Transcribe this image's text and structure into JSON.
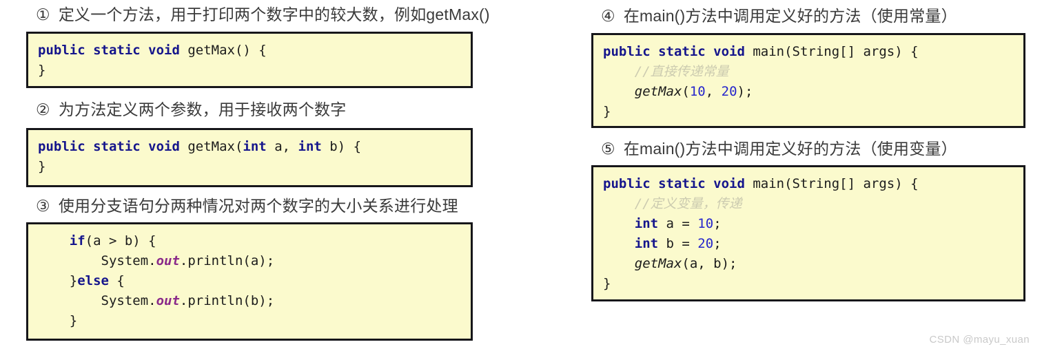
{
  "watermark": "CSDN @mayu_xuan",
  "theme": {
    "page_background": "#ffffff",
    "code_background": "#fbfacd",
    "code_border": "#16161a",
    "keyword_color": "#15158c",
    "number_color": "#2626cc",
    "comment_color": "#cccbb0",
    "field_color": "#8a2a8a",
    "heading_color": "#3a3a3a",
    "watermark_color": "#c9c9c9"
  },
  "sections": [
    {
      "marker": "①",
      "heading": "定义一个方法，用于打印两个数字中的较大数，例如getMax()",
      "code_lines": [
        {
          "tokens": [
            {
              "t": "public static void",
              "c": "kw"
            },
            {
              "t": " getMax() {",
              "c": "pl"
            }
          ]
        },
        {
          "tokens": [
            {
              "t": "}",
              "c": "pl"
            }
          ]
        }
      ]
    },
    {
      "marker": "②",
      "heading": "为方法定义两个参数，用于接收两个数字",
      "code_lines": [
        {
          "tokens": [
            {
              "t": "public static void",
              "c": "kw"
            },
            {
              "t": " getMax(",
              "c": "pl"
            },
            {
              "t": "int",
              "c": "kw"
            },
            {
              "t": " a, ",
              "c": "pl"
            },
            {
              "t": "int",
              "c": "kw"
            },
            {
              "t": " b) {",
              "c": "pl"
            }
          ]
        },
        {
          "tokens": [
            {
              "t": "}",
              "c": "pl"
            }
          ]
        }
      ]
    },
    {
      "marker": "③",
      "heading": "使用分支语句分两种情况对两个数字的大小关系进行处理",
      "code_lines": [
        {
          "tokens": [
            {
              "t": "    ",
              "c": "pl"
            },
            {
              "t": "if",
              "c": "kw"
            },
            {
              "t": "(a > b) {",
              "c": "pl"
            }
          ]
        },
        {
          "tokens": [
            {
              "t": "        System.",
              "c": "pl"
            },
            {
              "t": "out",
              "c": "fld"
            },
            {
              "t": ".println(a);",
              "c": "pl"
            }
          ]
        },
        {
          "tokens": [
            {
              "t": "    }",
              "c": "pl"
            },
            {
              "t": "else",
              "c": "kw"
            },
            {
              "t": " {",
              "c": "pl"
            }
          ]
        },
        {
          "tokens": [
            {
              "t": "        System.",
              "c": "pl"
            },
            {
              "t": "out",
              "c": "fld"
            },
            {
              "t": ".println(b);",
              "c": "pl"
            }
          ]
        },
        {
          "tokens": [
            {
              "t": "    }",
              "c": "pl"
            }
          ]
        }
      ]
    },
    {
      "marker": "④",
      "heading": "在main()方法中调用定义好的方法（使用常量）",
      "code_lines": [
        {
          "tokens": [
            {
              "t": "public static void",
              "c": "kw"
            },
            {
              "t": " main(String[] args) {",
              "c": "pl"
            }
          ]
        },
        {
          "tokens": [
            {
              "t": "    ",
              "c": "pl"
            },
            {
              "t": "//直接传递常量",
              "c": "cmt"
            }
          ]
        },
        {
          "tokens": [
            {
              "t": "    ",
              "c": "pl"
            },
            {
              "t": "getMax",
              "c": "ital"
            },
            {
              "t": "(",
              "c": "pl"
            },
            {
              "t": "10",
              "c": "num"
            },
            {
              "t": ", ",
              "c": "pl"
            },
            {
              "t": "20",
              "c": "num"
            },
            {
              "t": ");",
              "c": "pl"
            }
          ]
        },
        {
          "tokens": [
            {
              "t": "}",
              "c": "pl"
            }
          ]
        }
      ]
    },
    {
      "marker": "⑤",
      "heading": "在main()方法中调用定义好的方法（使用变量）",
      "code_lines": [
        {
          "tokens": [
            {
              "t": "public static void",
              "c": "kw"
            },
            {
              "t": " main(String[] args) {",
              "c": "pl"
            }
          ]
        },
        {
          "tokens": [
            {
              "t": "    ",
              "c": "pl"
            },
            {
              "t": "//定义变量，传递",
              "c": "cmt"
            }
          ]
        },
        {
          "tokens": [
            {
              "t": "    ",
              "c": "pl"
            },
            {
              "t": "int",
              "c": "kw"
            },
            {
              "t": " a = ",
              "c": "pl"
            },
            {
              "t": "10",
              "c": "num"
            },
            {
              "t": ";",
              "c": "pl"
            }
          ]
        },
        {
          "tokens": [
            {
              "t": "    ",
              "c": "pl"
            },
            {
              "t": "int",
              "c": "kw"
            },
            {
              "t": " b = ",
              "c": "pl"
            },
            {
              "t": "20",
              "c": "num"
            },
            {
              "t": ";",
              "c": "pl"
            }
          ]
        },
        {
          "tokens": [
            {
              "t": "    ",
              "c": "pl"
            },
            {
              "t": "getMax",
              "c": "ital"
            },
            {
              "t": "(a, b);",
              "c": "pl"
            }
          ]
        },
        {
          "tokens": [
            {
              "t": "}",
              "c": "pl"
            }
          ]
        }
      ]
    }
  ]
}
